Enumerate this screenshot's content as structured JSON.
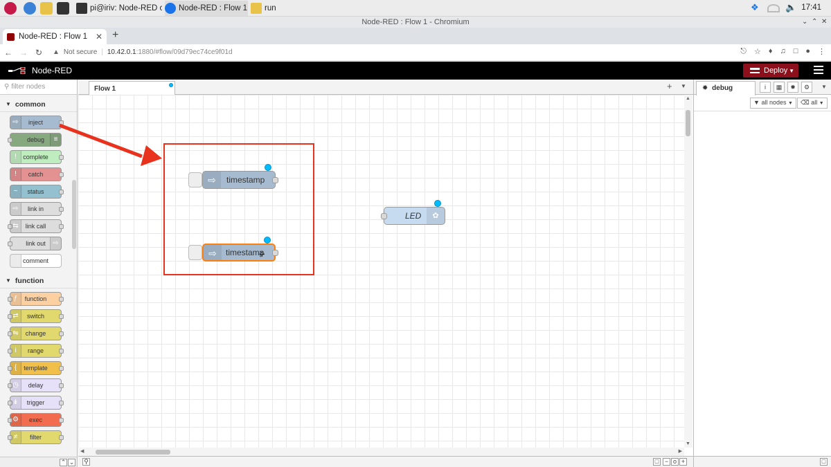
{
  "taskbar": {
    "tasks": [
      "pi@iriv: Node-RED co...",
      "Node-RED : Flow 1 - ...",
      "run"
    ],
    "clock": "17:41"
  },
  "browser": {
    "window_title": "Node-RED : Flow 1 - Chromium",
    "tab_title": "Node-RED : Flow 1",
    "url_security": "Not secure",
    "url_host": "10.42.0.1",
    "url_rest": ":1880/#flow/09d79ec74ce9f01d"
  },
  "nodered": {
    "app_name": "Node-RED",
    "deploy_label": "Deploy",
    "palette": {
      "filter_placeholder": "filter nodes",
      "categories": [
        {
          "name": "common",
          "nodes": [
            {
              "label": "inject",
              "color": "#a6bbcf"
            },
            {
              "label": "debug",
              "color": "#87a980"
            },
            {
              "label": "complete",
              "color": "#c0edc0"
            },
            {
              "label": "catch",
              "color": "#e49191"
            },
            {
              "label": "status",
              "color": "#94c1d0"
            },
            {
              "label": "link in",
              "color": "#dddddd"
            },
            {
              "label": "link call",
              "color": "#dddddd"
            },
            {
              "label": "link out",
              "color": "#dddddd"
            },
            {
              "label": "comment",
              "color": "#ffffff"
            }
          ]
        },
        {
          "name": "function",
          "nodes": [
            {
              "label": "function",
              "color": "#fdd0a2"
            },
            {
              "label": "switch",
              "color": "#e2d96e"
            },
            {
              "label": "change",
              "color": "#e2d96e"
            },
            {
              "label": "range",
              "color": "#e2d96e"
            },
            {
              "label": "template",
              "color": "#f0c04a"
            },
            {
              "label": "delay",
              "color": "#e6e0f8"
            },
            {
              "label": "trigger",
              "color": "#e6e0f8"
            },
            {
              "label": "exec",
              "color": "#f26d4f"
            },
            {
              "label": "filter",
              "color": "#e2d96e"
            }
          ]
        }
      ]
    },
    "workspace": {
      "flow_tab": "Flow 1",
      "nodes": [
        {
          "label": "timestamp",
          "type": "inject",
          "color": "#a6bbcf"
        },
        {
          "label": "timestamp",
          "type": "inject",
          "color": "#a6bbcf",
          "selected": true
        },
        {
          "label": "LED",
          "type": "rpi-gpio out",
          "color": "#c6dbef"
        }
      ]
    },
    "sidebar": {
      "tab_label": "debug",
      "filter_nodes": "all nodes",
      "filter_level": "all"
    },
    "annotation_color": "#e8321e"
  }
}
